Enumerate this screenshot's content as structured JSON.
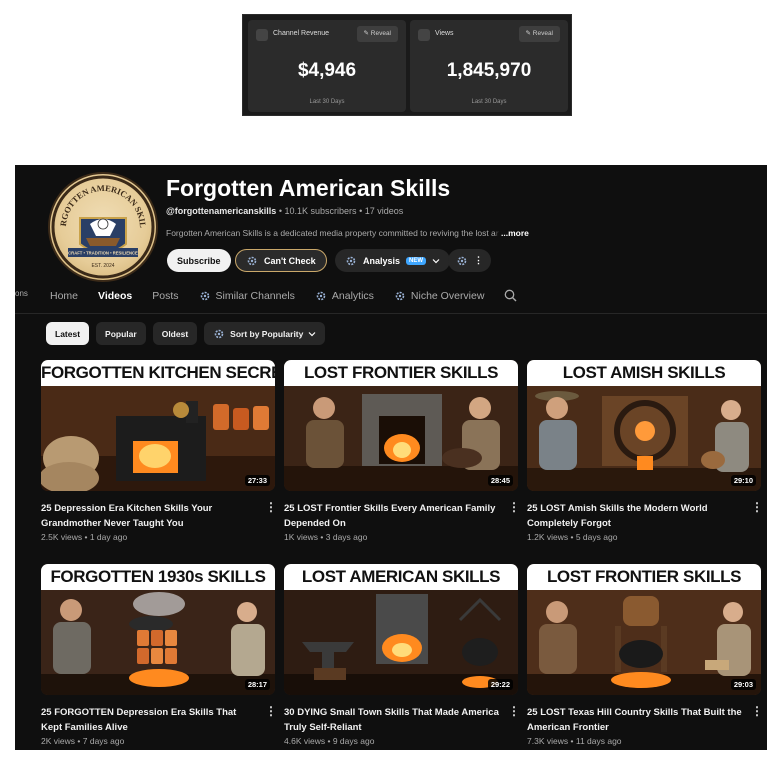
{
  "stats": [
    {
      "icon": "eye-icon",
      "label": "Channel Revenue",
      "reveal": "Reveal",
      "value": "$4,946",
      "period": "Last 30 Days"
    },
    {
      "icon": "eye-icon",
      "label": "Views",
      "reveal": "Reveal",
      "value": "1,845,970",
      "period": "Last 30 Days"
    }
  ],
  "sidebar_fragment": "ons",
  "channel": {
    "name": "Forgotten American Skills",
    "handle": "@forgottenamericanskills",
    "subscribers": "10.1K subscribers",
    "videos_count": "17 videos",
    "separator": "•",
    "description": "Forgotten American Skills is a dedicated media property committed to reviving the lost a",
    "description_fade": "r",
    "more": "...more",
    "avatar_text_top": "FORGOTTEN AMERICAN SKILLS",
    "avatar_text_band": "CRAFT • TRADITION • RESILIENCE",
    "avatar_text_bottom": "EST. 2024"
  },
  "buttons": {
    "subscribe": "Subscribe",
    "cant_check": "Can't Check",
    "analysis": "Analysis",
    "new_badge": "NEW",
    "more_dots": "⋮"
  },
  "tabs": [
    {
      "label": "Home"
    },
    {
      "label": "Videos"
    },
    {
      "label": "Posts"
    },
    {
      "label": "Similar Channels"
    },
    {
      "label": "Analytics"
    },
    {
      "label": "Niche Overview"
    }
  ],
  "chips": {
    "latest": "Latest",
    "popular": "Popular",
    "oldest": "Oldest",
    "sort": "Sort by Popularity"
  },
  "videos": [
    {
      "banner": "FORGOTTEN KITCHEN SECRETS",
      "duration": "27:33",
      "title": "25 Depression Era Kitchen Skills Your Grandmother Never Taught You",
      "views": "2.5K views",
      "age": "1 day ago"
    },
    {
      "banner": "LOST FRONTIER SKILLS",
      "duration": "28:45",
      "title": "25 LOST Frontier Skills Every American Family Depended On",
      "views": "1K views",
      "age": "3 days ago"
    },
    {
      "banner": "LOST AMISH SKILLS",
      "duration": "29:10",
      "title": "25 LOST Amish Skills the Modern World Completely Forgot",
      "views": "1.2K views",
      "age": "5 days ago"
    },
    {
      "banner": "FORGOTTEN 1930s SKILLS",
      "duration": "28:17",
      "title": "25 FORGOTTEN Depression Era Skills That Kept Families Alive",
      "views": "2K views",
      "age": "7 days ago"
    },
    {
      "banner": "LOST AMERICAN SKILLS",
      "duration": "29:22",
      "title": "30 DYING Small Town Skills That Made America Truly Self-Reliant",
      "views": "4.6K views",
      "age": "9 days ago"
    },
    {
      "banner": "LOST FRONTIER SKILLS",
      "duration": "29:03",
      "title": "25 LOST Texas Hill Country Skills That Built the American Frontier",
      "views": "7.3K views",
      "age": "11 days ago"
    }
  ],
  "colors": {
    "page_bg": "#0f0f0f",
    "accent_blue": "#3ea6ff",
    "fire": "#ff8a1f",
    "wood": "#6b3b1c"
  }
}
